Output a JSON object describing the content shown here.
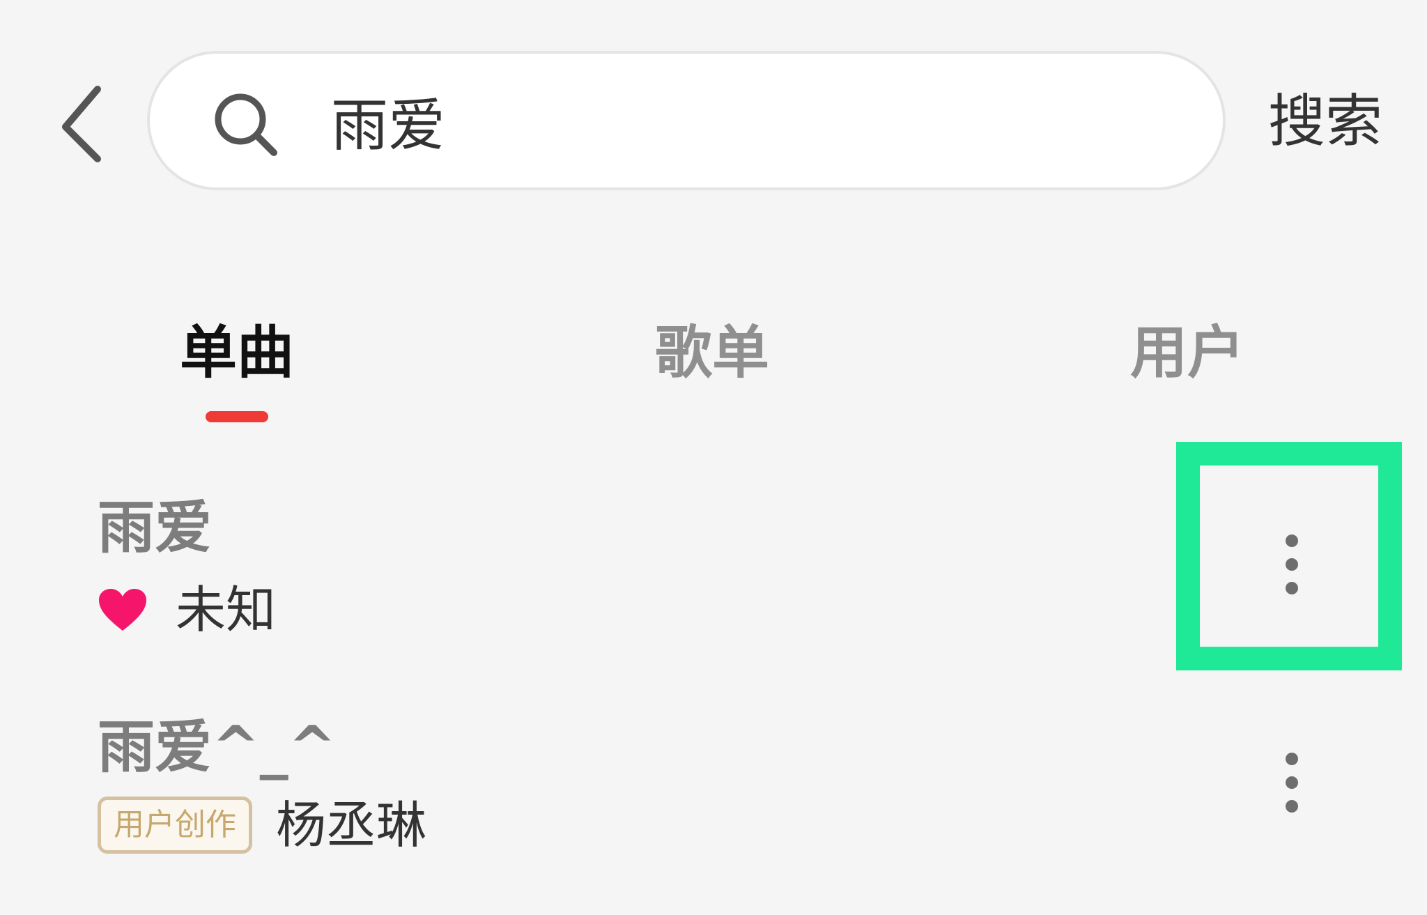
{
  "header": {
    "search_query": "雨爱",
    "search_button_label": "搜索"
  },
  "tabs": [
    {
      "label": "单曲",
      "active": true
    },
    {
      "label": "歌单",
      "active": false
    },
    {
      "label": "用户",
      "active": false
    }
  ],
  "songs": [
    {
      "title": "雨爱",
      "artist": "未知",
      "icon": "heart-icon"
    },
    {
      "title": "雨爱^_^",
      "badge": "用户创作",
      "artist": "杨丞琳"
    }
  ],
  "colors": {
    "accent": "#ef3b36",
    "heart": "#f5166b",
    "highlight": "#1fe996",
    "badge_text": "#c6a86f"
  }
}
